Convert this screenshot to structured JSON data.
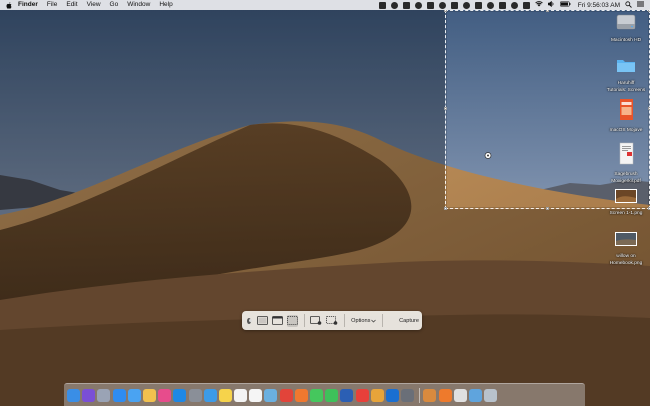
{
  "menubar": {
    "apple_icon": "apple-icon",
    "items": [
      "Finder",
      "File",
      "Edit",
      "View",
      "Go",
      "Window",
      "Help"
    ],
    "clock": "Fri 9:56:03 AM"
  },
  "desktop_icons": [
    {
      "label_line1": "Macintosh HD",
      "label_line2": "",
      "icon": "hard-drive-icon"
    },
    {
      "label_line1": "Haruhiff",
      "label_line2": "Tutorials: Screens",
      "icon": "folder-icon"
    },
    {
      "label_line1": "macOS Mojave",
      "label_line2": "",
      "icon": "document-icon"
    },
    {
      "label_line1": "Sagebrush",
      "label_line2": "Moxigerkil.pdf",
      "icon": "pdf-icon"
    },
    {
      "label_line1": "Screen 1-1.png",
      "label_line2": "",
      "icon": "image-file-icon"
    },
    {
      "label_line1": "willow on",
      "label_line2": "Homebook.png",
      "icon": "image-file-icon"
    }
  ],
  "capture_toolbar": {
    "options_label": "Options",
    "options_chevron": "chevron-down-icon",
    "capture_label": "Capture",
    "buttons": [
      "capture-entire-screen-icon",
      "capture-window-icon",
      "capture-selection-icon",
      "record-screen-icon",
      "record-selection-icon"
    ]
  },
  "dock": {
    "icons": [
      {
        "name": "finder",
        "color": "#3a8ee6"
      },
      {
        "name": "siri",
        "color": "#7a4fd6"
      },
      {
        "name": "launchpad",
        "color": "#9aa3b5"
      },
      {
        "name": "safari",
        "color": "#2f8cf0"
      },
      {
        "name": "mail",
        "color": "#4aa3f2"
      },
      {
        "name": "photos",
        "color": "#f2c14e"
      },
      {
        "name": "itunes",
        "color": "#e74c8c"
      },
      {
        "name": "app-store",
        "color": "#1e88e5"
      },
      {
        "name": "system-preferences",
        "color": "#8a8f98"
      },
      {
        "name": "safari-2",
        "color": "#3c9be8"
      },
      {
        "name": "notes",
        "color": "#f6d34b"
      },
      {
        "name": "calendar",
        "color": "#f3f3f3"
      },
      {
        "name": "reminders",
        "color": "#f5f5f5"
      },
      {
        "name": "preview",
        "color": "#6ab0e0"
      },
      {
        "name": "chrome",
        "color": "#e2443a"
      },
      {
        "name": "firefox",
        "color": "#f0782f"
      },
      {
        "name": "messages",
        "color": "#45c75d"
      },
      {
        "name": "facetime",
        "color": "#3ec15a"
      },
      {
        "name": "word",
        "color": "#2b5fb4"
      },
      {
        "name": "news",
        "color": "#e8403a"
      },
      {
        "name": "butterfly",
        "color": "#e7a43a"
      },
      {
        "name": "1password",
        "color": "#1a6fd1"
      },
      {
        "name": "quicktime",
        "color": "#6a6f78"
      },
      {
        "name": "photos-2",
        "color": "#d98a3e"
      },
      {
        "name": "books",
        "color": "#ee7a2c"
      },
      {
        "name": "scripts",
        "color": "#e0e0e0"
      },
      {
        "name": "downloads",
        "color": "#5fa4dd"
      },
      {
        "name": "trash",
        "color": "#b8c2cc"
      }
    ]
  }
}
